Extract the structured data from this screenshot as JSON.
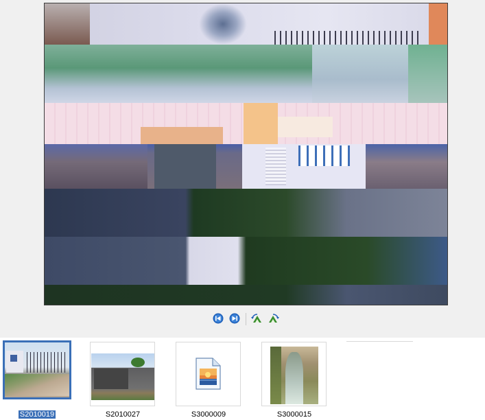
{
  "viewer": {
    "preview_alt": "S2010019"
  },
  "toolbar": {
    "prev_icon": "previous-image-icon",
    "next_icon": "next-image-icon",
    "rotate_ccw_icon": "rotate-counterclockwise-icon",
    "rotate_cw_icon": "rotate-clockwise-icon"
  },
  "thumbnails": [
    {
      "label": "S2010019",
      "selected": true
    },
    {
      "label": "S2010027",
      "selected": false
    },
    {
      "label": "S3000009",
      "selected": false
    },
    {
      "label": "S3000015",
      "selected": false
    }
  ],
  "colors": {
    "selection": "#3a6fb7",
    "toolbar_blue": "#1e5fb8",
    "toolbar_green": "#3a8f2e"
  }
}
